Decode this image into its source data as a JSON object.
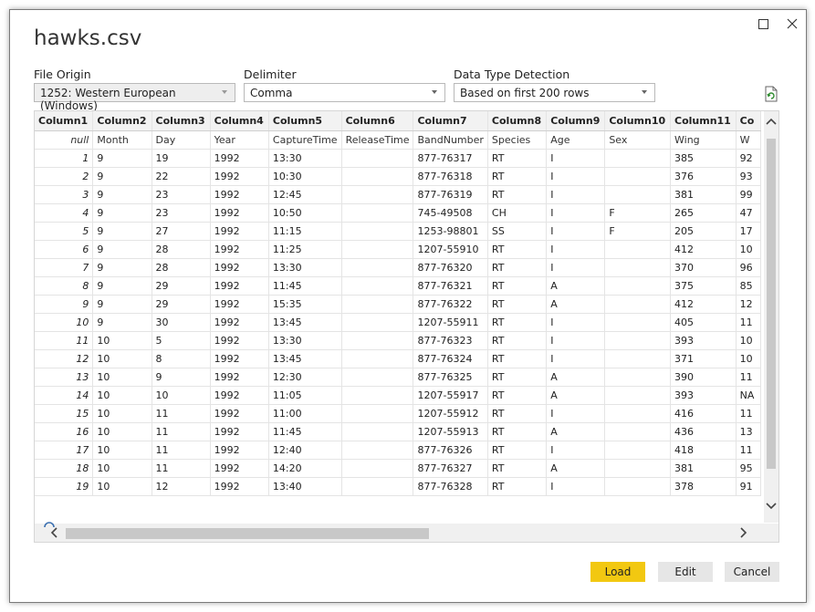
{
  "window": {
    "title": "hawks.csv"
  },
  "file_origin": {
    "label": "File Origin",
    "value": "1252: Western European (Windows)"
  },
  "delimiter": {
    "label": "Delimiter",
    "value": "Comma"
  },
  "detection": {
    "label": "Data Type Detection",
    "value": "Based on first 200 rows"
  },
  "table": {
    "headers": [
      "Column1",
      "Column2",
      "Column3",
      "Column4",
      "Column5",
      "Column6",
      "Column7",
      "Column8",
      "Column9",
      "Column10",
      "Column11",
      "Co"
    ],
    "subheader": [
      "null",
      "Month",
      "Day",
      "Year",
      "CaptureTime",
      "ReleaseTime",
      "BandNumber",
      "Species",
      "Age",
      "Sex",
      "Wing",
      "W"
    ],
    "rows": [
      [
        "1",
        "9",
        "19",
        "1992",
        "13:30",
        "",
        "877-76317",
        "RT",
        "I",
        "",
        "385",
        "92"
      ],
      [
        "2",
        "9",
        "22",
        "1992",
        "10:30",
        "",
        "877-76318",
        "RT",
        "I",
        "",
        "376",
        "93"
      ],
      [
        "3",
        "9",
        "23",
        "1992",
        "12:45",
        "",
        "877-76319",
        "RT",
        "I",
        "",
        "381",
        "99"
      ],
      [
        "4",
        "9",
        "23",
        "1992",
        "10:50",
        "",
        "745-49508",
        "CH",
        "I",
        "F",
        "265",
        "47"
      ],
      [
        "5",
        "9",
        "27",
        "1992",
        "11:15",
        "",
        "1253-98801",
        "SS",
        "I",
        "F",
        "205",
        "17"
      ],
      [
        "6",
        "9",
        "28",
        "1992",
        "11:25",
        "",
        "1207-55910",
        "RT",
        "I",
        "",
        "412",
        "10"
      ],
      [
        "7",
        "9",
        "28",
        "1992",
        "13:30",
        "",
        "877-76320",
        "RT",
        "I",
        "",
        "370",
        "96"
      ],
      [
        "8",
        "9",
        "29",
        "1992",
        "11:45",
        "",
        "877-76321",
        "RT",
        "A",
        "",
        "375",
        "85"
      ],
      [
        "9",
        "9",
        "29",
        "1992",
        "15:35",
        "",
        "877-76322",
        "RT",
        "A",
        "",
        "412",
        "12"
      ],
      [
        "10",
        "9",
        "30",
        "1992",
        "13:45",
        "",
        "1207-55911",
        "RT",
        "I",
        "",
        "405",
        "11"
      ],
      [
        "11",
        "10",
        "5",
        "1992",
        "13:30",
        "",
        "877-76323",
        "RT",
        "I",
        "",
        "393",
        "10"
      ],
      [
        "12",
        "10",
        "8",
        "1992",
        "13:45",
        "",
        "877-76324",
        "RT",
        "I",
        "",
        "371",
        "10"
      ],
      [
        "13",
        "10",
        "9",
        "1992",
        "12:30",
        "",
        "877-76325",
        "RT",
        "A",
        "",
        "390",
        "11"
      ],
      [
        "14",
        "10",
        "10",
        "1992",
        "11:05",
        "",
        "1207-55917",
        "RT",
        "A",
        "",
        "393",
        "NA"
      ],
      [
        "15",
        "10",
        "11",
        "1992",
        "11:00",
        "",
        "1207-55912",
        "RT",
        "I",
        "",
        "416",
        "11"
      ],
      [
        "16",
        "10",
        "11",
        "1992",
        "11:45",
        "",
        "1207-55913",
        "RT",
        "A",
        "",
        "436",
        "13"
      ],
      [
        "17",
        "10",
        "11",
        "1992",
        "12:40",
        "",
        "877-76326",
        "RT",
        "I",
        "",
        "418",
        "11"
      ],
      [
        "18",
        "10",
        "11",
        "1992",
        "14:20",
        "",
        "877-76327",
        "RT",
        "A",
        "",
        "381",
        "95"
      ],
      [
        "19",
        "10",
        "12",
        "1992",
        "13:40",
        "",
        "877-76328",
        "RT",
        "I",
        "",
        "378",
        "91"
      ]
    ]
  },
  "buttons": {
    "load": "Load",
    "edit": "Edit",
    "cancel": "Cancel"
  },
  "colors": {
    "load_bg": "#f2c811",
    "refresh_icon": "#2e8b2e"
  },
  "icons": [
    "maximize-icon",
    "close-icon",
    "chevron-down-icon",
    "refresh-icon",
    "chevron-up-icon",
    "chevron-left-icon",
    "chevron-right-icon",
    "loading-spinner-icon"
  ]
}
